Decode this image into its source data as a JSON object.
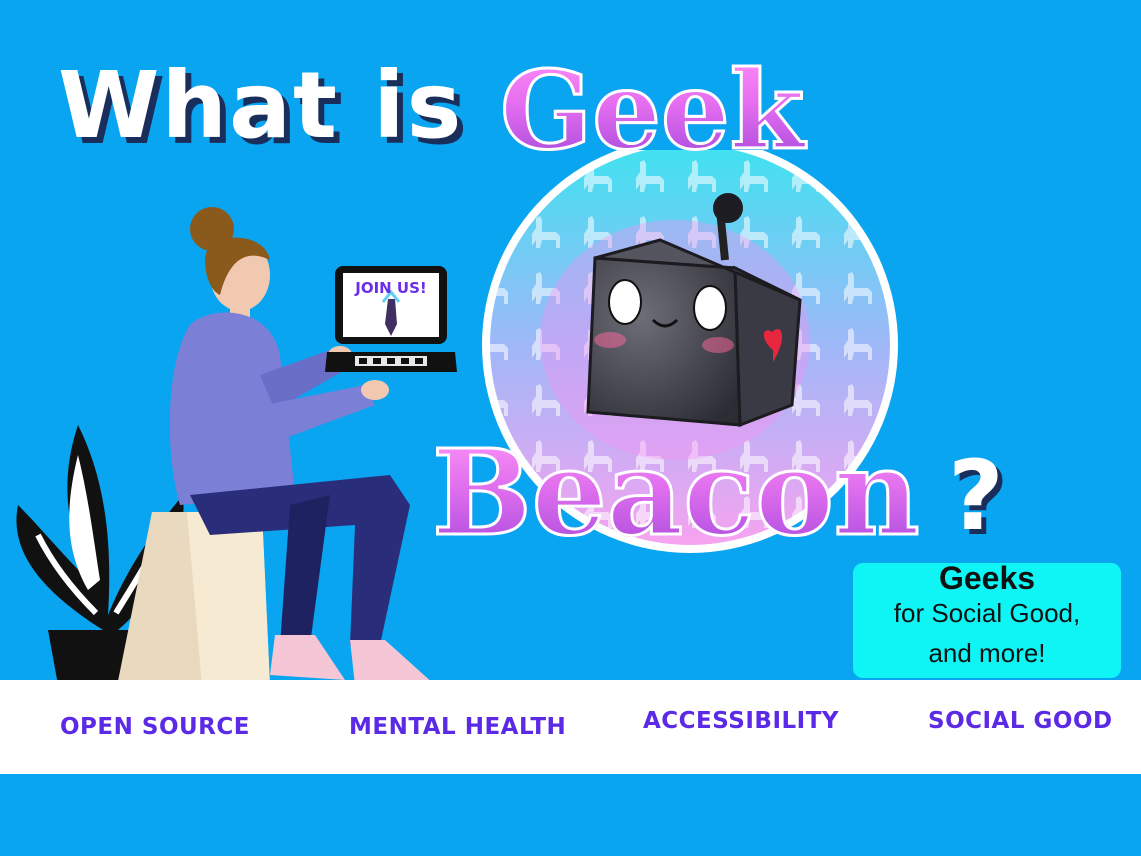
{
  "title": {
    "line1": "What is",
    "line2": "Geek",
    "line3": "Beacon",
    "mark": "?"
  },
  "laptop": {
    "screen_text": "JOIN US!"
  },
  "tagline": {
    "line1": "Geeks",
    "line2": "for Social Good,",
    "line3": "and more!"
  },
  "topics": [
    "OPEN SOURCE",
    "MENTAL HEALTH",
    "ACCESSIBILITY",
    "SOCIAL GOOD"
  ],
  "colors": {
    "background": "#0aa5f0",
    "accent_purple": "#5b2ae6",
    "tagline_box": "#0ff5f5",
    "title_pink": "#e36df0"
  },
  "icons": [
    "robot-mascot-icon",
    "person-with-laptop-illustration",
    "plant-icon",
    "stool-icon"
  ]
}
